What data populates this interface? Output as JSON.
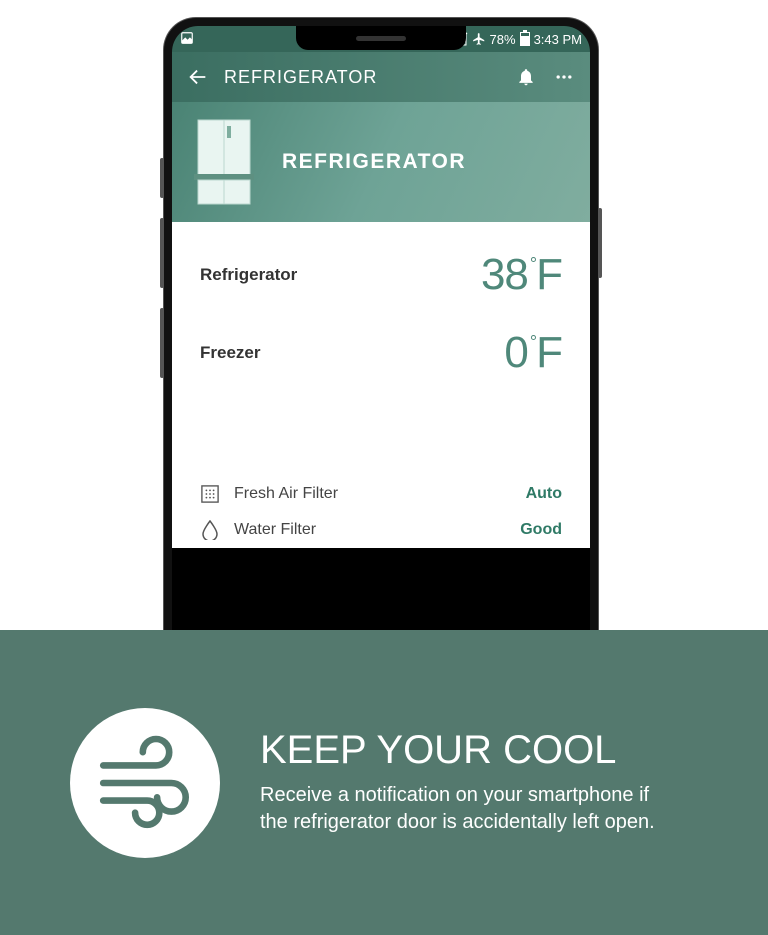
{
  "status": {
    "battery_pct": "78%",
    "time": "3:43 PM"
  },
  "appbar": {
    "title": "REFRIGERATOR"
  },
  "hero": {
    "title": "REFRIGERATOR"
  },
  "temps": {
    "refrigerator": {
      "label": "Refrigerator",
      "value": "38",
      "unit": "F"
    },
    "freezer": {
      "label": "Freezer",
      "value": "0",
      "unit": "F"
    }
  },
  "filters": {
    "air": {
      "label": "Fresh Air Filter",
      "value": "Auto"
    },
    "water": {
      "label": "Water Filter",
      "value": "Good"
    }
  },
  "promo": {
    "title": "KEEP YOUR COOL",
    "body": "Receive a notification on your smartphone if the refrigerator door is accidentally left open."
  }
}
